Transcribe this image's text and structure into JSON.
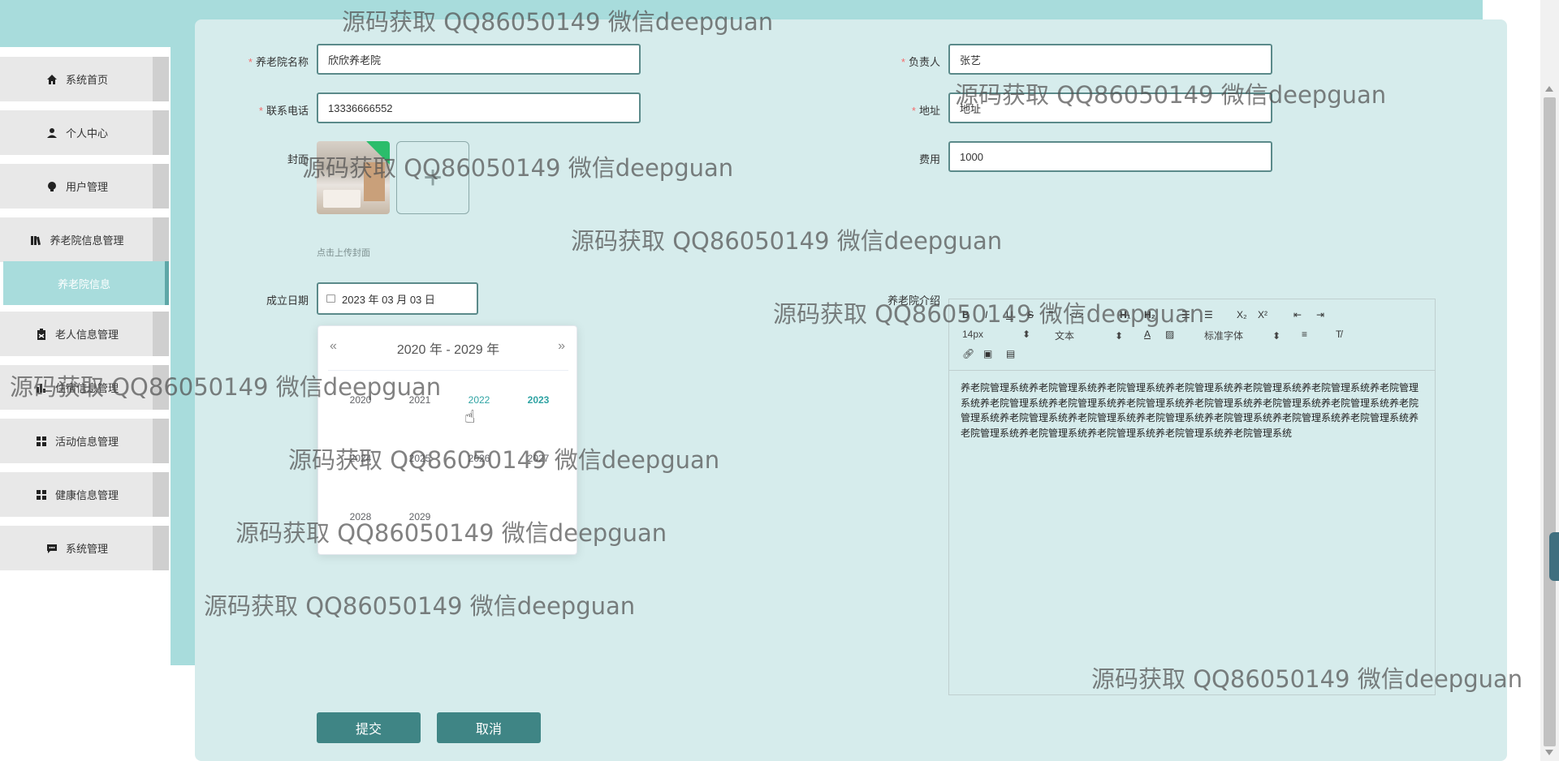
{
  "sidebar": {
    "items": [
      {
        "label": "系统首页",
        "icon": "home-icon"
      },
      {
        "label": "个人中心",
        "icon": "user-icon"
      },
      {
        "label": "用户管理",
        "icon": "bulb-icon"
      },
      {
        "label": "养老院信息管理",
        "icon": "books-icon"
      },
      {
        "label": "老人信息管理",
        "icon": "clipboard-icon"
      },
      {
        "label": "住宿信息管理",
        "icon": "bar-chart-icon"
      },
      {
        "label": "活动信息管理",
        "icon": "grid-icon"
      },
      {
        "label": "健康信息管理",
        "icon": "grid-icon"
      },
      {
        "label": "系统管理",
        "icon": "chat-icon"
      }
    ],
    "submenu_active": "养老院信息"
  },
  "form": {
    "name_label": "养老院名称",
    "name_value": "欣欣养老院",
    "manager_label": "负责人",
    "manager_value": "张艺",
    "phone_label": "联系电话",
    "phone_value": "13336666552",
    "address_label": "地址",
    "address_value": "地址",
    "cover_label": "封面",
    "fee_label": "费用",
    "fee_value": "1000",
    "upload_plus": "+",
    "upload_tip": "点击上传封面",
    "date_label": "成立日期",
    "date_value": "2023 年 03 月 03 日",
    "intro_label": "养老院介绍"
  },
  "picker": {
    "prev": "«",
    "next": "»",
    "header": "2020 年 - 2029 年",
    "years": [
      "2020",
      "2021",
      "2022",
      "2023",
      "2024",
      "2025",
      "2026",
      "2027",
      "2028",
      "2029"
    ],
    "hovered_year": "2022",
    "current_year": "2023"
  },
  "editor": {
    "font_size": "14px",
    "text_type": "文本",
    "font_family": "标准字体",
    "content": "养老院管理系统养老院管理系统养老院管理系统养老院管理系统养老院管理系统养老院管理系统养老院管理系统养老院管理系统养老院管理系统养老院管理系统养老院管理系统养老院管理系统养老院管理系统养老院管理系统养老院管理系统养老院管理系统养老院管理系统养老院管理系统养老院管理系统养老院管理系统养老院管理系统养老院管理系统养老院管理系统养老院管理系统养老院管理系统"
  },
  "buttons": {
    "submit": "提交",
    "cancel": "取消"
  },
  "watermark": "源码获取 QQ86050149 微信deepguan",
  "colors": {
    "teal_light": "#a8dcdc",
    "panel": "#d6ecec",
    "button": "#3f8585",
    "required": "#f56c6c",
    "year_highlight": "#2fa3a3"
  }
}
